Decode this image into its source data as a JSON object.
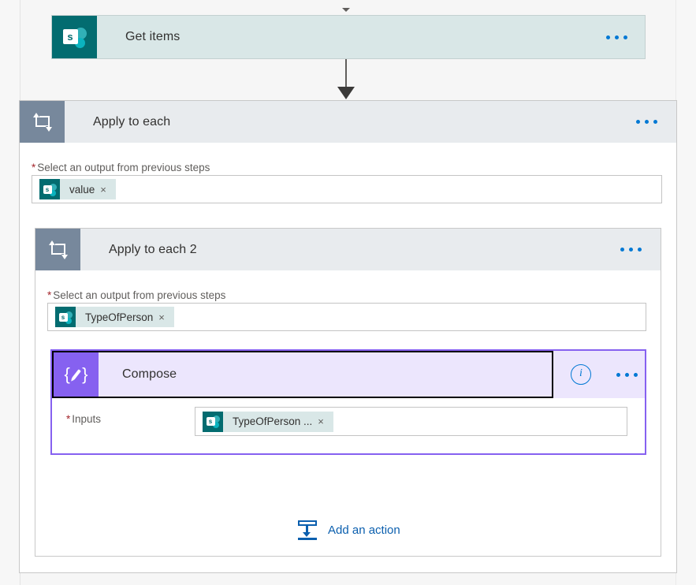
{
  "flow": {
    "steps": [
      {
        "id": "get-items",
        "title": "Get items",
        "icon": "sharepoint-icon",
        "icon_letter": "s",
        "menu": "more-options"
      },
      {
        "id": "apply-to-each",
        "title": "Apply to each",
        "icon": "loop-icon",
        "field": {
          "label": "Select an output from previous steps",
          "required_marker": "*",
          "token": {
            "text": "value",
            "remove": "×",
            "icon": "sharepoint-icon",
            "icon_letter": "s"
          }
        }
      },
      {
        "id": "apply-to-each-2",
        "title": "Apply to each 2",
        "icon": "loop-icon",
        "field": {
          "label": "Select an output from previous steps",
          "required_marker": "*",
          "token": {
            "text": "TypeOfPerson",
            "remove": "×",
            "icon": "sharepoint-icon",
            "icon_letter": "s"
          }
        }
      },
      {
        "id": "compose",
        "title": "Compose",
        "icon": "compose-braces-pencil-icon",
        "selected": true,
        "info": "i",
        "field": {
          "label": "Inputs",
          "required_marker": "*",
          "token": {
            "text": "TypeOfPerson ...",
            "remove": "×",
            "icon": "sharepoint-icon",
            "icon_letter": "s"
          }
        }
      }
    ],
    "add_action": {
      "label": "Add an action",
      "icon": "insert-action-icon"
    }
  },
  "colors": {
    "sharepoint_teal": "#036c70",
    "sharepoint_card_bg": "#d9e7e7",
    "scope_header_bg": "#e8ebee",
    "scope_icon_bg": "#77889c",
    "compose_purple": "#8661f0",
    "compose_card_bg": "#ece6fd",
    "accent_blue": "#0078d4",
    "link_blue": "#0b5fae",
    "required_red": "#a4262c",
    "canvas_bg": "#f6f6f6"
  }
}
